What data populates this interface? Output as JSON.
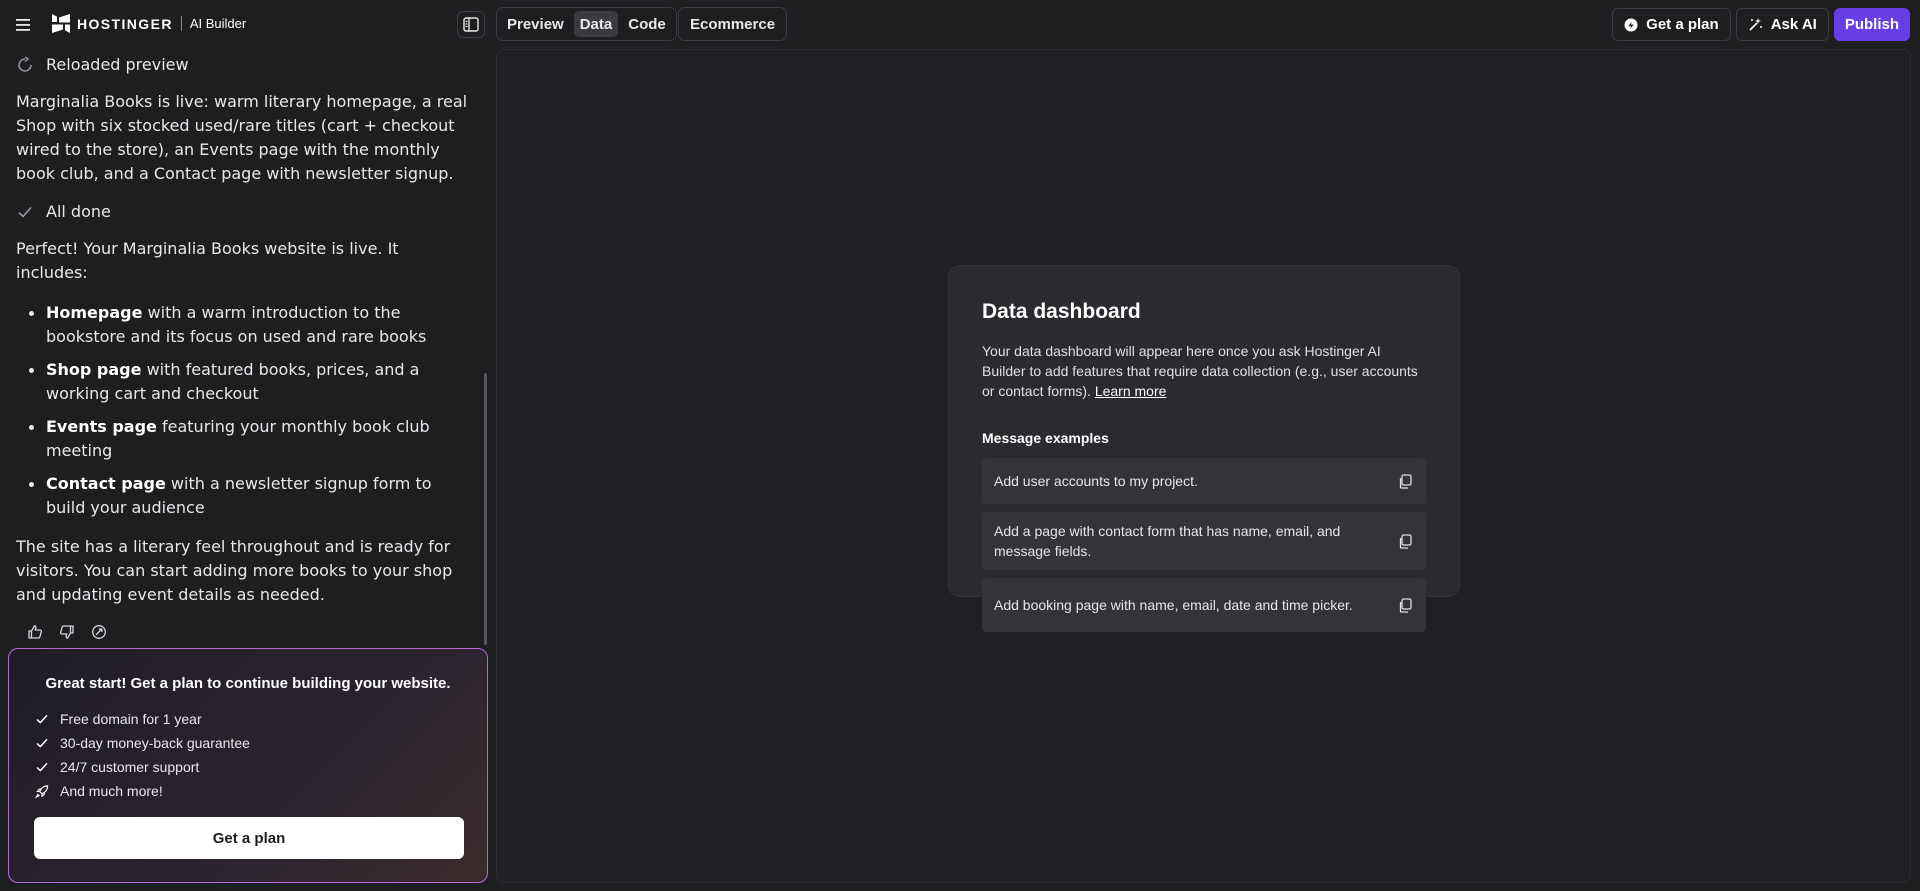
{
  "header": {
    "brand": "HOSTINGER",
    "product": "AI Builder",
    "tabs": [
      {
        "label": "Preview",
        "active": false
      },
      {
        "label": "Data",
        "active": true
      },
      {
        "label": "Code",
        "active": false
      }
    ],
    "ecommerce_label": "Ecommerce",
    "get_plan_label": "Get a plan",
    "ask_ai_label": "Ask AI",
    "publish_label": "Publish",
    "accent_color": "#673de6"
  },
  "chat": {
    "reload_status": "Reloaded preview",
    "summary": "Marginalia Books is live: warm literary homepage, a real Shop with six stocked used/rare titles (cart + checkout wired to the store), an Events page with the monthly book club, and a Contact page with newsletter signup.",
    "done_status": "All done",
    "intro": "Perfect! Your Marginalia Books website is live. It includes:",
    "features": [
      {
        "bold": "Homepage",
        "rest": " with a warm introduction to the bookstore and its focus on used and rare books"
      },
      {
        "bold": "Shop page",
        "rest": " with featured books, prices, and a working cart and checkout"
      },
      {
        "bold": "Events page",
        "rest": " featuring your monthly book club meeting"
      },
      {
        "bold": "Contact page",
        "rest": " with a newsletter signup form to build your audience"
      }
    ],
    "closing": "The site has a literary feel throughout and is ready for visitors. You can start adding more books to your shop and updating event details as needed."
  },
  "promo": {
    "title": "Great start! Get a plan to continue building your website.",
    "items": [
      {
        "icon": "check-icon",
        "text": "Free domain for 1 year"
      },
      {
        "icon": "check-icon",
        "text": "30-day money-back guarantee"
      },
      {
        "icon": "check-icon",
        "text": "24/7 customer support"
      },
      {
        "icon": "rocket-icon",
        "text": "And much more!"
      }
    ],
    "button_label": "Get a plan",
    "border_color": "#b06cd6"
  },
  "dashboard": {
    "title": "Data dashboard",
    "description": "Your data dashboard will appear here once you ask Hostinger AI Builder to add features that require data collection (e.g., user accounts or contact forms).",
    "learn_more": "Learn more",
    "examples_heading": "Message examples",
    "examples": [
      "Add user accounts to my project.",
      "Add a page with contact form that has name, email, and message fields.",
      "Add booking page with name, email, date and time picker."
    ]
  }
}
